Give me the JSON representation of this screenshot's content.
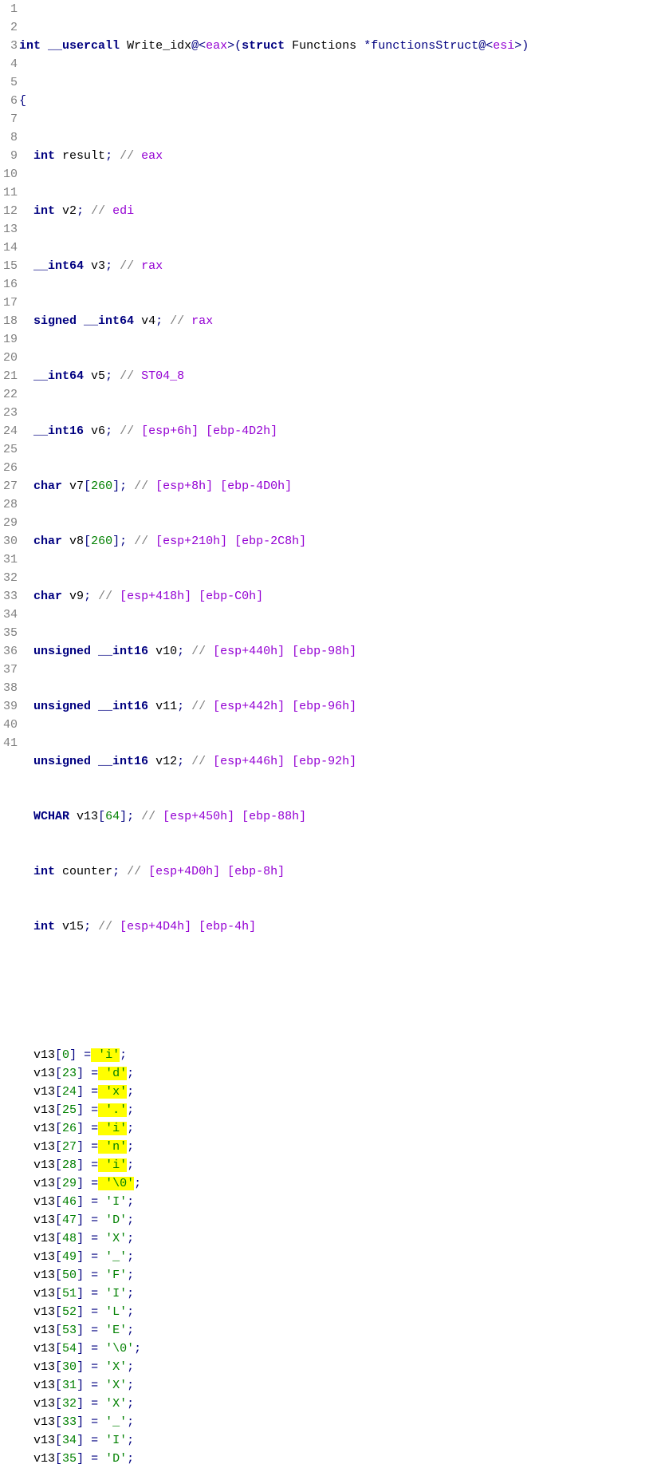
{
  "func_signature": {
    "ret_type": "int",
    "callconv": "__usercall",
    "name": "Write_idx",
    "at1": "@<",
    "reg1": "eax",
    "close1": ">(",
    "struct_kw": "struct",
    "struct_name": "Functions",
    "star_param": "*functionsStruct",
    "at2": "@<",
    "reg2": "esi",
    "close2": ">)"
  },
  "brace_open": "{",
  "decls": {
    "l3": {
      "indent": "  ",
      "t": "int",
      "n": "result",
      "sc": ";",
      "cm": " // ",
      "r": "eax"
    },
    "l4": {
      "indent": "  ",
      "t": "int",
      "n": "v2",
      "sc": ";",
      "cm": " // ",
      "r": "edi"
    },
    "l5": {
      "indent": "  ",
      "t": "__int64",
      "n": "v3",
      "sc": ";",
      "cm": " // ",
      "r": "rax"
    },
    "l6": {
      "indent": "  ",
      "t1": "signed",
      "t2": "__int64",
      "n": "v4",
      "sc": ";",
      "cm": " // ",
      "r": "rax"
    },
    "l7": {
      "indent": "  ",
      "t": "__int64",
      "n": "v5",
      "sc": ";",
      "cm": " // ",
      "r": "ST04_8"
    },
    "l8": {
      "indent": "  ",
      "t": "__int16",
      "n": "v6",
      "sc": ";",
      "cm": " // ",
      "r": "[esp+6h] [ebp-4D2h]"
    },
    "l9": {
      "indent": "  ",
      "t": "char",
      "n": "v7",
      "lb": "[",
      "sz": "260",
      "rb": "]",
      "sc": ";",
      "cm": " // ",
      "r": "[esp+8h] [ebp-4D0h]"
    },
    "l10": {
      "indent": "  ",
      "t": "char",
      "n": "v8",
      "lb": "[",
      "sz": "260",
      "rb": "]",
      "sc": ";",
      "cm": " // ",
      "r": "[esp+210h] [ebp-2C8h]"
    },
    "l11": {
      "indent": "  ",
      "t": "char",
      "n": "v9",
      "sc": ";",
      "cm": " // ",
      "r": "[esp+418h] [ebp-C0h]"
    },
    "l12": {
      "indent": "  ",
      "t1": "unsigned",
      "t2": "__int16",
      "n": "v10",
      "sc": ";",
      "cm": " // ",
      "r": "[esp+440h] [ebp-98h]"
    },
    "l13": {
      "indent": "  ",
      "t1": "unsigned",
      "t2": "__int16",
      "n": "v11",
      "sc": ";",
      "cm": " // ",
      "r": "[esp+442h] [ebp-96h]"
    },
    "l14": {
      "indent": "  ",
      "t1": "unsigned",
      "t2": "__int16",
      "n": "v12",
      "sc": ";",
      "cm": " // ",
      "r": "[esp+446h] [ebp-92h]"
    },
    "l15": {
      "indent": "  ",
      "t": "WCHAR",
      "n": "v13",
      "lb": "[",
      "sz": "64",
      "rb": "]",
      "sc": ";",
      "cm": " // ",
      "r": "[esp+450h] [ebp-88h]"
    },
    "l16": {
      "indent": "  ",
      "t": "int",
      "n": "counter",
      "sc": ";",
      "cm": " // ",
      "r": "[esp+4D0h] [ebp-8h]"
    },
    "l17": {
      "indent": "  ",
      "t": "int",
      "n": "v15",
      "sc": ";",
      "cm": " // ",
      "r": "[esp+4D4h] [ebp-4h]"
    }
  },
  "assigns": [
    {
      "ln": 19,
      "arr": "v13",
      "idx": "0",
      "val": "'i'",
      "hl": true
    },
    {
      "ln": 20,
      "arr": "v13",
      "idx": "23",
      "val": "'d'",
      "hl": true
    },
    {
      "ln": 21,
      "arr": "v13",
      "idx": "24",
      "val": "'x'",
      "hl": true
    },
    {
      "ln": 22,
      "arr": "v13",
      "idx": "25",
      "val": "'.'",
      "hl": true
    },
    {
      "ln": 23,
      "arr": "v13",
      "idx": "26",
      "val": "'i'",
      "hl": true
    },
    {
      "ln": 24,
      "arr": "v13",
      "idx": "27",
      "val": "'n'",
      "hl": true
    },
    {
      "ln": 25,
      "arr": "v13",
      "idx": "28",
      "val": "'i'",
      "hl": true
    },
    {
      "ln": 26,
      "arr": "v13",
      "idx": "29",
      "val": "'\\0'",
      "hl": true
    },
    {
      "ln": 27,
      "arr": "v13",
      "idx": "46",
      "val": "'I'",
      "hl": false
    },
    {
      "ln": 28,
      "arr": "v13",
      "idx": "47",
      "val": "'D'",
      "hl": false
    },
    {
      "ln": 29,
      "arr": "v13",
      "idx": "48",
      "val": "'X'",
      "hl": false
    },
    {
      "ln": 30,
      "arr": "v13",
      "idx": "49",
      "val": "'_'",
      "hl": false
    },
    {
      "ln": 31,
      "arr": "v13",
      "idx": "50",
      "val": "'F'",
      "hl": false
    },
    {
      "ln": 32,
      "arr": "v13",
      "idx": "51",
      "val": "'I'",
      "hl": false
    },
    {
      "ln": 33,
      "arr": "v13",
      "idx": "52",
      "val": "'L'",
      "hl": false
    },
    {
      "ln": 34,
      "arr": "v13",
      "idx": "53",
      "val": "'E'",
      "hl": false
    },
    {
      "ln": 35,
      "arr": "v13",
      "idx": "54",
      "val": "'\\0'",
      "hl": false
    },
    {
      "ln": 36,
      "arr": "v13",
      "idx": "30",
      "val": "'X'",
      "hl": false
    },
    {
      "ln": 37,
      "arr": "v13",
      "idx": "31",
      "val": "'X'",
      "hl": false
    },
    {
      "ln": 38,
      "arr": "v13",
      "idx": "32",
      "val": "'X'",
      "hl": false
    },
    {
      "ln": 39,
      "arr": "v13",
      "idx": "33",
      "val": "'_'",
      "hl": false
    },
    {
      "ln": 40,
      "arr": "v13",
      "idx": "34",
      "val": "'I'",
      "hl": false
    },
    {
      "ln": 41,
      "arr": "v13",
      "idx": "35",
      "val": "'D'",
      "hl": false
    }
  ],
  "line_count": 41
}
